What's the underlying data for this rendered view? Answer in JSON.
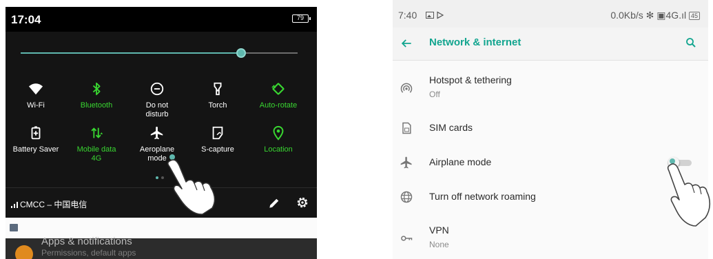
{
  "left_panel": {
    "status": {
      "time": "17:04",
      "battery": "79"
    },
    "brightness_level": 0.8,
    "tiles": [
      {
        "label": "Wi-Fi",
        "sub": "",
        "icon": "wifi-icon",
        "active": false
      },
      {
        "label": "Bluetooth",
        "sub": "",
        "icon": "bluetooth-icon",
        "active": true
      },
      {
        "label": "Do not",
        "sub": "disturb",
        "icon": "do-not-disturb-icon",
        "active": false
      },
      {
        "label": "Torch",
        "sub": "",
        "icon": "torch-icon",
        "active": false
      },
      {
        "label": "Auto-rotate",
        "sub": "",
        "icon": "auto-rotate-icon",
        "active": true
      },
      {
        "label": "Battery Saver",
        "sub": "",
        "icon": "battery-saver-icon",
        "active": false
      },
      {
        "label": "Mobile data",
        "sub": "4G",
        "icon": "mobile-data-icon",
        "active": true
      },
      {
        "label": "Aeroplane",
        "sub": "mode",
        "icon": "airplane-icon",
        "active": false
      },
      {
        "label": "S-capture",
        "sub": "",
        "icon": "screenshot-icon",
        "active": false
      },
      {
        "label": "Location",
        "sub": "",
        "icon": "location-icon",
        "active": true
      }
    ],
    "carrier": "CMCC – 中国电信",
    "behind_list": {
      "title": "Apps & notifications",
      "subtitle": "Permissions, default apps"
    },
    "colors": {
      "active": "#39d631",
      "accent": "#5fb8ae",
      "panel": "#141414"
    }
  },
  "right_panel": {
    "status": {
      "time": "7:40",
      "speed": "0.0Kb/s ✻ ▣4G.ıl",
      "battery": "45"
    },
    "header": {
      "title": "Network & internet"
    },
    "rows": [
      {
        "title": "Hotspot & tethering",
        "subtitle": "Off",
        "icon": "hotspot-icon"
      },
      {
        "title": "SIM cards",
        "subtitle": "",
        "icon": "sim-card-icon"
      },
      {
        "title": "Airplane mode",
        "subtitle": "",
        "icon": "airplane-icon"
      },
      {
        "title": "Turn off network roaming",
        "subtitle": "",
        "icon": "globe-icon"
      },
      {
        "title": "VPN",
        "subtitle": "None",
        "icon": "vpn-key-icon"
      }
    ],
    "airplane_mode_on": false,
    "colors": {
      "accent": "#12a58f"
    }
  }
}
